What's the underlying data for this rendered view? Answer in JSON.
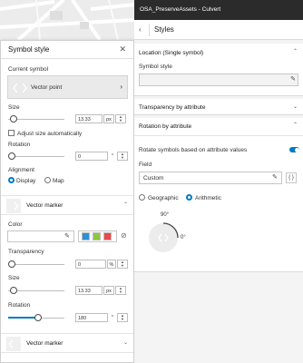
{
  "app": {
    "title": "OSA_PreserveAssets - Culvert"
  },
  "symbol_style": {
    "title": "Symbol style",
    "current_symbol_label": "Current symbol",
    "current_symbol_name": "Vector point",
    "size_label": "Size",
    "size_value": "13.33",
    "size_unit": "px",
    "adjust_size_label": "Adjust size automatically",
    "rotation_label": "Rotation",
    "rotation_value": "0",
    "rotation_unit": "°",
    "alignment_label": "Alignment",
    "alignment_options": [
      "Display",
      "Map"
    ],
    "alignment_selected": "Display",
    "vector_marker_title": "Vector marker",
    "color_label": "Color",
    "color_swatches": [
      "#2f8fd8",
      "#8dc63f",
      "#e8494b"
    ],
    "transparency_label": "Transparency",
    "transparency_value": "0",
    "transparency_unit": "%",
    "marker_size_label": "Size",
    "marker_size_value": "13.33",
    "marker_size_unit": "px",
    "marker_rotation_label": "Rotation",
    "marker_rotation_value": "180",
    "marker_rotation_unit": "°",
    "vector_marker_2_title": "Vector marker"
  },
  "styles_panel": {
    "title": "Styles",
    "location_title": "Location (Single symbol)",
    "symbol_style_label": "Symbol style",
    "transparency_title": "Transparency by attribute",
    "rotation_title": "Rotation by attribute",
    "rotate_toggle_label": "Rotate symbols based on attribute values",
    "rotate_enabled": true,
    "field_label": "Field",
    "field_value": "Custom",
    "field_expression_icon": "{ }",
    "rotation_modes": [
      "Geographic",
      "Arithmetic"
    ],
    "rotation_mode_selected": "Arithmetic",
    "dial_top_label": "90°",
    "dial_right_label": "0°"
  },
  "colors": {
    "accent": "#007ac2",
    "top_bar": "#2b2b2b"
  }
}
